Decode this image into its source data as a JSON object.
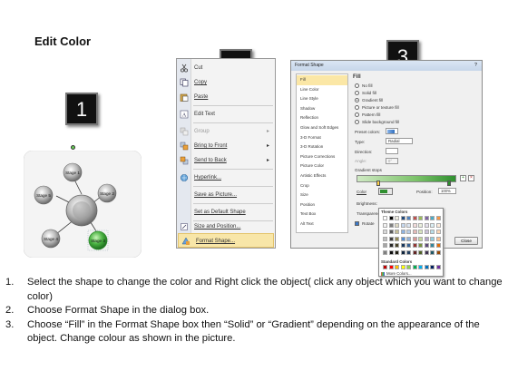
{
  "title": "Edit Color",
  "badges": [
    "1",
    "2",
    "3"
  ],
  "diagram": {
    "stages": [
      "Stage 1",
      "Stage 2",
      "Stage 3",
      "Stage 4",
      "Stage 5"
    ]
  },
  "context_menu": {
    "items": [
      {
        "label": "Cut",
        "icon": "scissors-icon"
      },
      {
        "label": "Copy",
        "icon": "copy-icon"
      },
      {
        "label": "Paste",
        "icon": "paste-icon"
      },
      {
        "label": "Edit Text",
        "icon": "edit-text-icon"
      },
      {
        "label": "Group",
        "icon": "group-icon",
        "submenu": true,
        "disabled": true
      },
      {
        "label": "Bring to Front",
        "icon": "bring-to-front-icon",
        "submenu": true
      },
      {
        "label": "Send to Back",
        "icon": "send-to-back-icon",
        "submenu": true
      },
      {
        "label": "Hyperlink...",
        "icon": "hyperlink-icon"
      },
      {
        "label": "Save as Picture...",
        "icon": ""
      },
      {
        "label": "Set as Default Shape",
        "icon": ""
      },
      {
        "label": "Size and Position...",
        "icon": "size-position-icon"
      },
      {
        "label": "Format Shape...",
        "icon": "format-shape-icon",
        "highlighted": true
      }
    ]
  },
  "format_dialog": {
    "title": "Format Shape",
    "nav": [
      "Fill",
      "Line Color",
      "Line Style",
      "Shadow",
      "Reflection",
      "Glow and Soft Edges",
      "3-D Format",
      "3-D Rotation",
      "Picture Corrections",
      "Picture Color",
      "Artistic Effects",
      "Crop",
      "Size",
      "Position",
      "Text Box",
      "Alt Text"
    ],
    "section": "Fill",
    "options": [
      "No fill",
      "Solid fill",
      "Gradient fill",
      "Picture or texture fill",
      "Pattern fill",
      "Slide background fill"
    ],
    "preset_label": "Preset colors:",
    "type_label": "Type:",
    "type_value": "Radial",
    "direction_label": "Direction:",
    "angle_label": "Angle:",
    "angle_value": "0°",
    "gradient_stops_label": "Gradient stops",
    "color_label": "Color",
    "position_label": "Position:",
    "position_value": "100%",
    "brightness_label": "Brightness:",
    "transparency_label": "Transparency:",
    "rotate_label": "Rotate",
    "theme_colors_label": "Theme Colors",
    "standard_colors_label": "Standard Colors",
    "more_colors_label": "More Colors...",
    "close_label": "Close"
  },
  "instructions": [
    {
      "n": "1.",
      "text": "Select the shape to change the color and Right click the object( click any object which you want to change color)"
    },
    {
      "n": "2.",
      "text": "Choose Format Shape in the dialog box."
    },
    {
      "n": "3.",
      "text": "Choose “Fill” in the Format Shape box then “Solid” or “Gradient” depending on the appearance of the object. Change colour as shown in the picture."
    }
  ],
  "colors": {
    "badge": "#111111",
    "highlight": "#f8e6a8",
    "selected_stage": "#3aa040",
    "gradient_green": "#2f8f2f"
  }
}
